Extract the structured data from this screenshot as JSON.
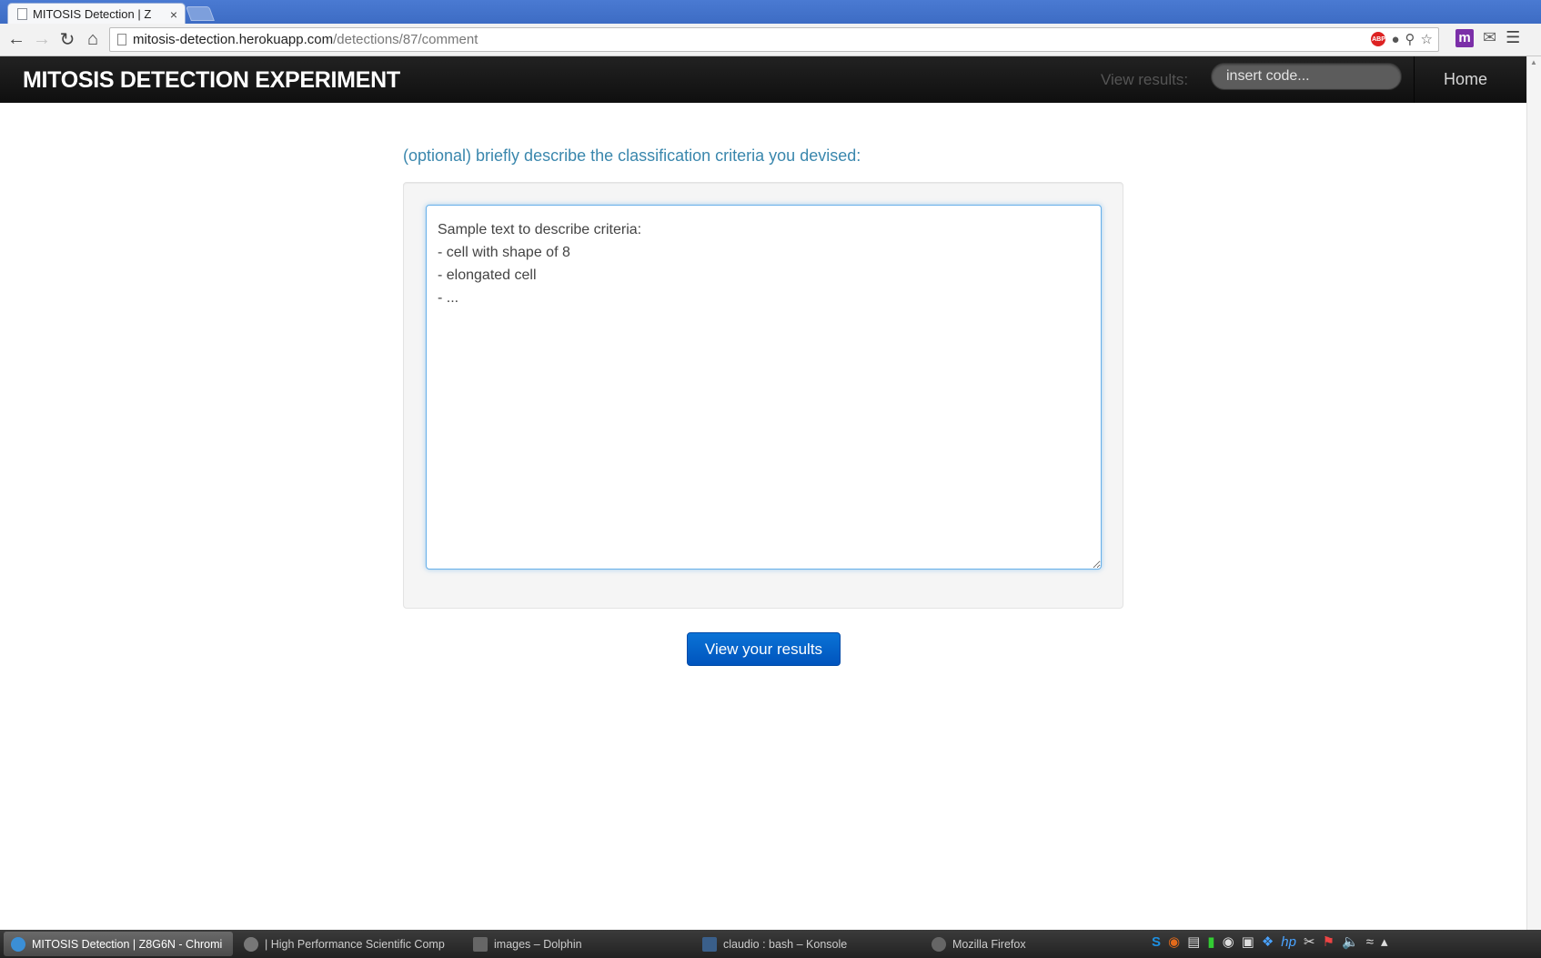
{
  "browser": {
    "tab_title": "MITOSIS Detection | Z",
    "tab_close": "×",
    "url_host": "mitosis-detection.herokuapp.com",
    "url_path": "/detections/87/comment",
    "abp_label": "ABP",
    "ext_m_label": "m"
  },
  "navbar": {
    "brand": "MITOSIS DETECTION EXPERIMENT",
    "view_results_label": "View results:",
    "code_placeholder": "insert code...",
    "home_label": "Home"
  },
  "main": {
    "prompt": "(optional) briefly describe the classification criteria you devised:",
    "criteria_text": "Sample text to describe criteria:\n- cell with shape of 8\n- elongated cell\n- ...",
    "submit_label": "View your results"
  },
  "taskbar": {
    "tasks": [
      {
        "label": "MITOSIS Detection | Z8G6N - Chromi"
      },
      {
        "label": "| High Performance Scientific Comp"
      },
      {
        "label": "images – Dolphin"
      },
      {
        "label": "claudio : bash – Konsole"
      },
      {
        "label": "Mozilla Firefox"
      }
    ]
  },
  "icons": {
    "back": "back-arrow-icon",
    "forward": "forward-arrow-icon",
    "reload": "reload-icon",
    "home": "home-icon"
  },
  "colors": {
    "navbar_bg": "#111111",
    "prompt": "#3a87ad",
    "button": "#0068c9",
    "tabstrip": "#4273cc"
  }
}
